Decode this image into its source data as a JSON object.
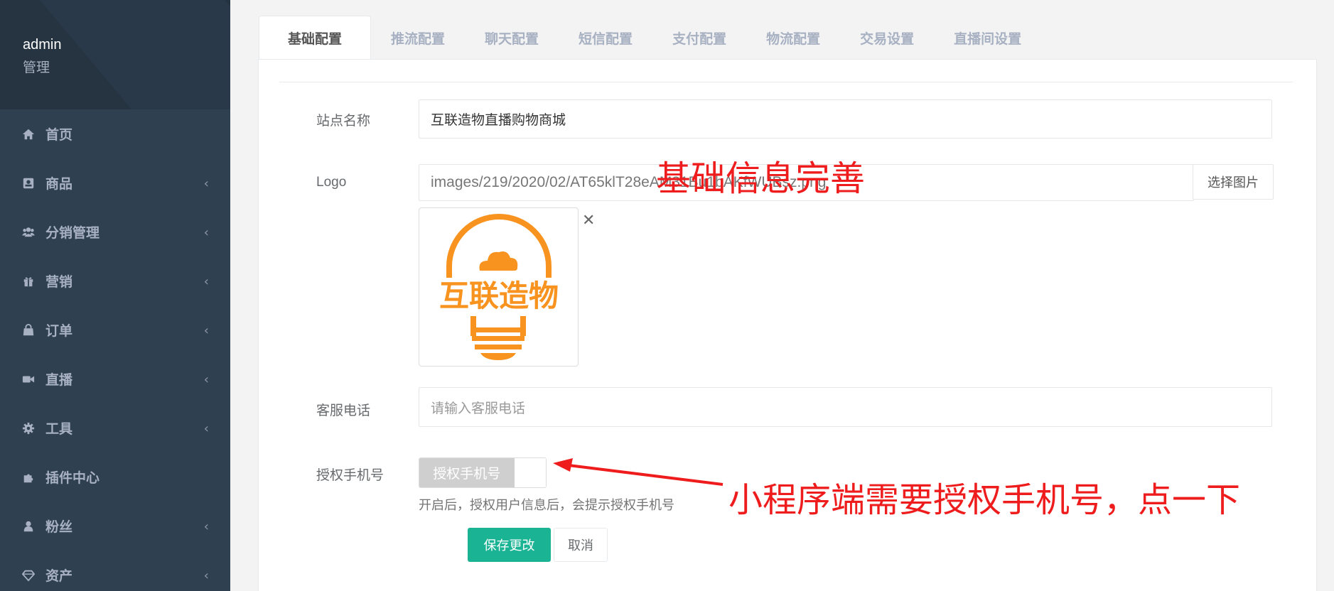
{
  "user": {
    "name": "admin",
    "role": "管理"
  },
  "sidebar": {
    "items": [
      {
        "label": "首页",
        "icon": "home-icon",
        "has_submenu": false
      },
      {
        "label": "商品",
        "icon": "product-icon",
        "has_submenu": true
      },
      {
        "label": "分销管理",
        "icon": "users-icon",
        "has_submenu": true
      },
      {
        "label": "营销",
        "icon": "gift-icon",
        "has_submenu": true
      },
      {
        "label": "订单",
        "icon": "shopping-bag-icon",
        "has_submenu": true
      },
      {
        "label": "直播",
        "icon": "video-camera-icon",
        "has_submenu": true
      },
      {
        "label": "工具",
        "icon": "gear-icon",
        "has_submenu": true
      },
      {
        "label": "插件中心",
        "icon": "puzzle-icon",
        "has_submenu": false
      },
      {
        "label": "粉丝",
        "icon": "user-icon",
        "has_submenu": true
      },
      {
        "label": "资产",
        "icon": "diamond-icon",
        "has_submenu": true
      }
    ],
    "chevron": "‹"
  },
  "tabs": [
    {
      "label": "基础配置",
      "active": true
    },
    {
      "label": "推流配置",
      "active": false
    },
    {
      "label": "聊天配置",
      "active": false
    },
    {
      "label": "短信配置",
      "active": false
    },
    {
      "label": "支付配置",
      "active": false
    },
    {
      "label": "物流配置",
      "active": false
    },
    {
      "label": "交易设置",
      "active": false
    },
    {
      "label": "直播间设置",
      "active": false
    }
  ],
  "form": {
    "site_name": {
      "label": "站点名称",
      "value": "互联造物直播购物商城"
    },
    "logo": {
      "label": "Logo",
      "path_value": "images/219/2020/02/AT65klT28eAM31Bu1bAKfWUBsz.png",
      "choose_button": "选择图片",
      "remove_icon": "close-icon",
      "logo_text": "互联造物"
    },
    "service_phone": {
      "label": "客服电话",
      "placeholder": "请输入客服电话"
    },
    "auth_phone": {
      "label": "授权手机号",
      "toggle_label": "授权手机号",
      "toggle_on": false,
      "help": "开启后，授权用户信息后，会提示授权手机号"
    },
    "save_button": "保存更改",
    "cancel_button": "取消"
  },
  "annotations": {
    "top": "基础信息完善",
    "bottom": "小程序端需要授权手机号，点一下"
  },
  "colors": {
    "sidebar_bg": "#2f4050",
    "primary": "#1ab394",
    "annotation": "#ee1c1c",
    "logo_orange": "#f7931e"
  }
}
